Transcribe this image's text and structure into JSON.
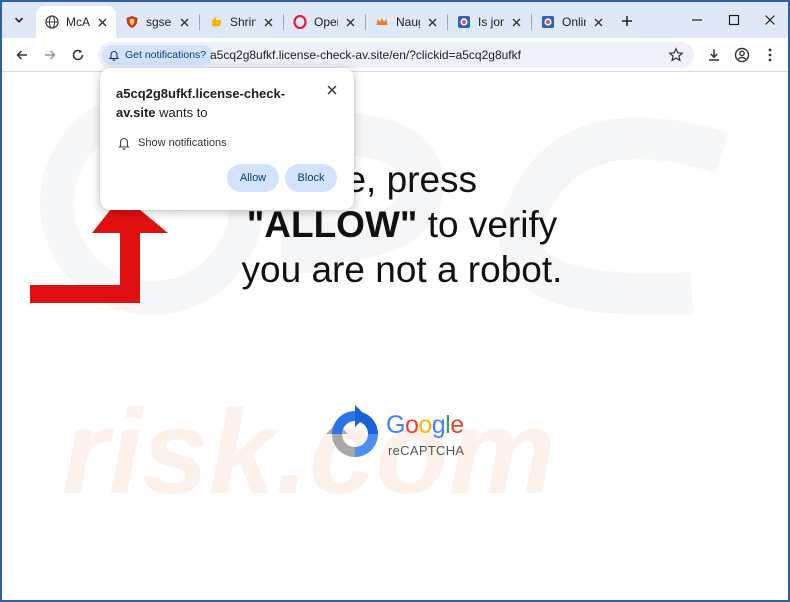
{
  "browser": {
    "tabs": [
      {
        "title": "McAfe",
        "icon": "globe-icon",
        "active": true
      },
      {
        "title": "sgseo",
        "icon": "shield-favicon-icon",
        "active": false
      },
      {
        "title": "Shrink",
        "icon": "hand-favicon-icon",
        "active": false
      },
      {
        "title": "Opera",
        "icon": "opera-favicon-icon",
        "active": false
      },
      {
        "title": "Naugh",
        "icon": "crown-favicon-icon",
        "active": false
      },
      {
        "title": "Is jord",
        "icon": "scam-favicon-icon",
        "active": false
      },
      {
        "title": "Online",
        "icon": "scam-favicon-icon",
        "active": false
      }
    ],
    "notification_chip": "Get notifications?",
    "url": "a5cq2g8ufkf.license-check-av.site/en/?clickid=a5cq2g8ufkf"
  },
  "popup": {
    "site": "a5cq2g8ufkf.license-check-av.site",
    "wants_to": " wants to",
    "permission": "Show notifications",
    "allow_label": "Allow",
    "block_label": "Block"
  },
  "page": {
    "line1": "se, press",
    "line2_bold": "\"ALLOW\"",
    "line2_rest": " to verify",
    "line3": "you are not a robot.",
    "recaptcha_brand": [
      "G",
      "o",
      "o",
      "g",
      "l",
      "e"
    ],
    "recaptcha_label": "reCAPTCHA"
  },
  "colors": {
    "frame": "#2f5fa7",
    "tabstrip": "#dfe8f7",
    "chip": "#d3e3fd",
    "arrow_red": "#e01010",
    "google": [
      "#4285f4",
      "#ea4335",
      "#fbbc05",
      "#4285f4",
      "#34a853",
      "#ea4335"
    ]
  }
}
